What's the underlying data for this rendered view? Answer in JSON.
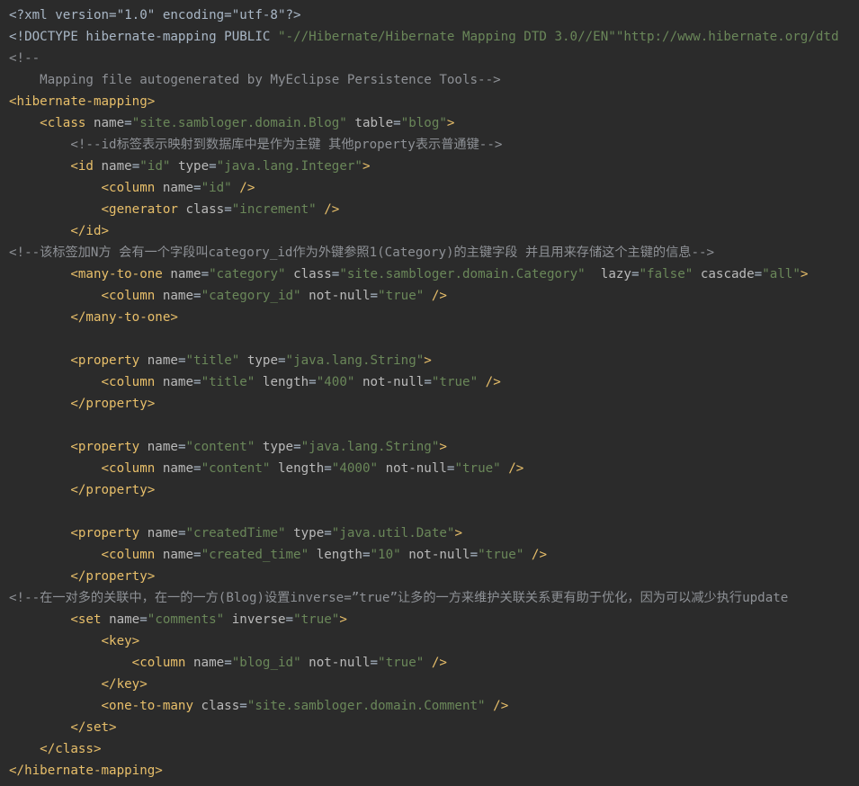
{
  "editor": {
    "language": "xml",
    "colors": {
      "background": "#2b2b2b",
      "text": "#a9b7c6",
      "tag": "#e8bf6a",
      "attribute_name": "#bababa",
      "attribute_value": "#6a8759",
      "comment": "#8e9196"
    },
    "lines": [
      {
        "indent": "",
        "tokens": [
          {
            "t": "pi",
            "v": "<?xml version=\"1.0\" encoding=\"utf-8\"?>"
          }
        ]
      },
      {
        "indent": "",
        "tokens": [
          {
            "t": "pun",
            "v": "<!DOCTYPE hibernate-mapping PUBLIC "
          },
          {
            "t": "atv",
            "v": "\"-//Hibernate/Hibernate Mapping DTD 3.0//EN\""
          },
          {
            "t": "atv",
            "v": "\"http://www.hibernate.org/dtd"
          }
        ]
      },
      {
        "indent": "",
        "tokens": [
          {
            "t": "cmt",
            "v": "<!--"
          }
        ]
      },
      {
        "indent": "    ",
        "tokens": [
          {
            "t": "cmt",
            "v": "Mapping file autogenerated by MyEclipse Persistence Tools-->"
          }
        ]
      },
      {
        "indent": "",
        "tokens": [
          {
            "t": "tag",
            "v": "<hibernate-mapping"
          },
          {
            "t": "tag",
            "v": ">"
          }
        ]
      },
      {
        "indent": "    ",
        "tokens": [
          {
            "t": "tag",
            "v": "<class "
          },
          {
            "t": "atn",
            "v": "name"
          },
          {
            "t": "pun",
            "v": "="
          },
          {
            "t": "atv",
            "v": "\"site.sambloger.domain.Blog\""
          },
          {
            "t": "pun",
            "v": " "
          },
          {
            "t": "atn",
            "v": "table"
          },
          {
            "t": "pun",
            "v": "="
          },
          {
            "t": "atv",
            "v": "\"blog\""
          },
          {
            "t": "tag",
            "v": ">"
          }
        ]
      },
      {
        "indent": "        ",
        "tokens": [
          {
            "t": "cmt",
            "v": "<!--id标签表示映射到数据库中是作为主键 其他property表示普通键-->"
          }
        ]
      },
      {
        "indent": "        ",
        "tokens": [
          {
            "t": "tag",
            "v": "<id "
          },
          {
            "t": "atn",
            "v": "name"
          },
          {
            "t": "pun",
            "v": "="
          },
          {
            "t": "atv",
            "v": "\"id\""
          },
          {
            "t": "pun",
            "v": " "
          },
          {
            "t": "atn",
            "v": "type"
          },
          {
            "t": "pun",
            "v": "="
          },
          {
            "t": "atv",
            "v": "\"java.lang.Integer\""
          },
          {
            "t": "tag",
            "v": ">"
          }
        ]
      },
      {
        "indent": "            ",
        "tokens": [
          {
            "t": "tag",
            "v": "<column "
          },
          {
            "t": "atn",
            "v": "name"
          },
          {
            "t": "pun",
            "v": "="
          },
          {
            "t": "atv",
            "v": "\"id\""
          },
          {
            "t": "pun",
            "v": " "
          },
          {
            "t": "tag",
            "v": "/>"
          }
        ]
      },
      {
        "indent": "            ",
        "tokens": [
          {
            "t": "tag",
            "v": "<generator "
          },
          {
            "t": "atn",
            "v": "class"
          },
          {
            "t": "pun",
            "v": "="
          },
          {
            "t": "atv",
            "v": "\"increment\""
          },
          {
            "t": "pun",
            "v": " "
          },
          {
            "t": "tag",
            "v": "/>"
          }
        ]
      },
      {
        "indent": "        ",
        "tokens": [
          {
            "t": "tag",
            "v": "</id>"
          }
        ]
      },
      {
        "indent": "",
        "tokens": [
          {
            "t": "cmt",
            "v": "<!--该标签加N方 会有一个字段叫category_id作为外键参照1(Category)的主键字段 并且用来存储这个主键的信息-->"
          }
        ]
      },
      {
        "indent": "        ",
        "tokens": [
          {
            "t": "tag",
            "v": "<many-to-one "
          },
          {
            "t": "atn",
            "v": "name"
          },
          {
            "t": "pun",
            "v": "="
          },
          {
            "t": "atv",
            "v": "\"category\""
          },
          {
            "t": "pun",
            "v": " "
          },
          {
            "t": "atn",
            "v": "class"
          },
          {
            "t": "pun",
            "v": "="
          },
          {
            "t": "atv",
            "v": "\"site.sambloger.domain.Category\""
          },
          {
            "t": "pun",
            "v": "  "
          },
          {
            "t": "atn",
            "v": "lazy"
          },
          {
            "t": "pun",
            "v": "="
          },
          {
            "t": "atv",
            "v": "\"false\""
          },
          {
            "t": "pun",
            "v": " "
          },
          {
            "t": "atn",
            "v": "cascade"
          },
          {
            "t": "pun",
            "v": "="
          },
          {
            "t": "atv",
            "v": "\"all\""
          },
          {
            "t": "tag",
            "v": ">"
          }
        ]
      },
      {
        "indent": "            ",
        "tokens": [
          {
            "t": "tag",
            "v": "<column "
          },
          {
            "t": "atn",
            "v": "name"
          },
          {
            "t": "pun",
            "v": "="
          },
          {
            "t": "atv",
            "v": "\"category_id\""
          },
          {
            "t": "pun",
            "v": " "
          },
          {
            "t": "atn",
            "v": "not-null"
          },
          {
            "t": "pun",
            "v": "="
          },
          {
            "t": "atv",
            "v": "\"true\""
          },
          {
            "t": "pun",
            "v": " "
          },
          {
            "t": "tag",
            "v": "/>"
          }
        ]
      },
      {
        "indent": "        ",
        "tokens": [
          {
            "t": "tag",
            "v": "</many-to-one>"
          }
        ]
      },
      {
        "indent": "",
        "tokens": []
      },
      {
        "indent": "        ",
        "tokens": [
          {
            "t": "tag",
            "v": "<property "
          },
          {
            "t": "atn",
            "v": "name"
          },
          {
            "t": "pun",
            "v": "="
          },
          {
            "t": "atv",
            "v": "\"title\""
          },
          {
            "t": "pun",
            "v": " "
          },
          {
            "t": "atn",
            "v": "type"
          },
          {
            "t": "pun",
            "v": "="
          },
          {
            "t": "atv",
            "v": "\"java.lang.String\""
          },
          {
            "t": "tag",
            "v": ">"
          }
        ]
      },
      {
        "indent": "            ",
        "tokens": [
          {
            "t": "tag",
            "v": "<column "
          },
          {
            "t": "atn",
            "v": "name"
          },
          {
            "t": "pun",
            "v": "="
          },
          {
            "t": "atv",
            "v": "\"title\""
          },
          {
            "t": "pun",
            "v": " "
          },
          {
            "t": "atn",
            "v": "length"
          },
          {
            "t": "pun",
            "v": "="
          },
          {
            "t": "atv",
            "v": "\"400\""
          },
          {
            "t": "pun",
            "v": " "
          },
          {
            "t": "atn",
            "v": "not-null"
          },
          {
            "t": "pun",
            "v": "="
          },
          {
            "t": "atv",
            "v": "\"true\""
          },
          {
            "t": "pun",
            "v": " "
          },
          {
            "t": "tag",
            "v": "/>"
          }
        ]
      },
      {
        "indent": "        ",
        "tokens": [
          {
            "t": "tag",
            "v": "</property>"
          }
        ]
      },
      {
        "indent": "",
        "tokens": []
      },
      {
        "indent": "        ",
        "tokens": [
          {
            "t": "tag",
            "v": "<property "
          },
          {
            "t": "atn",
            "v": "name"
          },
          {
            "t": "pun",
            "v": "="
          },
          {
            "t": "atv",
            "v": "\"content\""
          },
          {
            "t": "pun",
            "v": " "
          },
          {
            "t": "atn",
            "v": "type"
          },
          {
            "t": "pun",
            "v": "="
          },
          {
            "t": "atv",
            "v": "\"java.lang.String\""
          },
          {
            "t": "tag",
            "v": ">"
          }
        ]
      },
      {
        "indent": "            ",
        "tokens": [
          {
            "t": "tag",
            "v": "<column "
          },
          {
            "t": "atn",
            "v": "name"
          },
          {
            "t": "pun",
            "v": "="
          },
          {
            "t": "atv",
            "v": "\"content\""
          },
          {
            "t": "pun",
            "v": " "
          },
          {
            "t": "atn",
            "v": "length"
          },
          {
            "t": "pun",
            "v": "="
          },
          {
            "t": "atv",
            "v": "\"4000\""
          },
          {
            "t": "pun",
            "v": " "
          },
          {
            "t": "atn",
            "v": "not-null"
          },
          {
            "t": "pun",
            "v": "="
          },
          {
            "t": "atv",
            "v": "\"true\""
          },
          {
            "t": "pun",
            "v": " "
          },
          {
            "t": "tag",
            "v": "/>"
          }
        ]
      },
      {
        "indent": "        ",
        "tokens": [
          {
            "t": "tag",
            "v": "</property>"
          }
        ]
      },
      {
        "indent": "",
        "tokens": []
      },
      {
        "indent": "        ",
        "tokens": [
          {
            "t": "tag",
            "v": "<property "
          },
          {
            "t": "atn",
            "v": "name"
          },
          {
            "t": "pun",
            "v": "="
          },
          {
            "t": "atv",
            "v": "\"createdTime\""
          },
          {
            "t": "pun",
            "v": " "
          },
          {
            "t": "atn",
            "v": "type"
          },
          {
            "t": "pun",
            "v": "="
          },
          {
            "t": "atv",
            "v": "\"java.util.Date\""
          },
          {
            "t": "tag",
            "v": ">"
          }
        ]
      },
      {
        "indent": "            ",
        "tokens": [
          {
            "t": "tag",
            "v": "<column "
          },
          {
            "t": "atn",
            "v": "name"
          },
          {
            "t": "pun",
            "v": "="
          },
          {
            "t": "atv",
            "v": "\"created_time\""
          },
          {
            "t": "pun",
            "v": " "
          },
          {
            "t": "atn",
            "v": "length"
          },
          {
            "t": "pun",
            "v": "="
          },
          {
            "t": "atv",
            "v": "\"10\""
          },
          {
            "t": "pun",
            "v": " "
          },
          {
            "t": "atn",
            "v": "not-null"
          },
          {
            "t": "pun",
            "v": "="
          },
          {
            "t": "atv",
            "v": "\"true\""
          },
          {
            "t": "pun",
            "v": " "
          },
          {
            "t": "tag",
            "v": "/>"
          }
        ]
      },
      {
        "indent": "        ",
        "tokens": [
          {
            "t": "tag",
            "v": "</property>"
          }
        ]
      },
      {
        "indent": "",
        "tokens": [
          {
            "t": "cmt",
            "v": "<!--在一对多的关联中，在一的一方(Blog)设置inverse=”true”让多的一方来维护关联关系更有助于优化，因为可以减少执行update"
          }
        ]
      },
      {
        "indent": "        ",
        "tokens": [
          {
            "t": "tag",
            "v": "<set "
          },
          {
            "t": "atn",
            "v": "name"
          },
          {
            "t": "pun",
            "v": "="
          },
          {
            "t": "atv",
            "v": "\"comments\""
          },
          {
            "t": "pun",
            "v": " "
          },
          {
            "t": "atn",
            "v": "inverse"
          },
          {
            "t": "pun",
            "v": "="
          },
          {
            "t": "atv",
            "v": "\"true\""
          },
          {
            "t": "tag",
            "v": ">"
          }
        ]
      },
      {
        "indent": "            ",
        "tokens": [
          {
            "t": "tag",
            "v": "<key>"
          }
        ]
      },
      {
        "indent": "                ",
        "tokens": [
          {
            "t": "tag",
            "v": "<column "
          },
          {
            "t": "atn",
            "v": "name"
          },
          {
            "t": "pun",
            "v": "="
          },
          {
            "t": "atv",
            "v": "\"blog_id\""
          },
          {
            "t": "pun",
            "v": " "
          },
          {
            "t": "atn",
            "v": "not-null"
          },
          {
            "t": "pun",
            "v": "="
          },
          {
            "t": "atv",
            "v": "\"true\""
          },
          {
            "t": "pun",
            "v": " "
          },
          {
            "t": "tag",
            "v": "/>"
          }
        ]
      },
      {
        "indent": "            ",
        "tokens": [
          {
            "t": "tag",
            "v": "</key>"
          }
        ]
      },
      {
        "indent": "            ",
        "tokens": [
          {
            "t": "tag",
            "v": "<one-to-many "
          },
          {
            "t": "atn",
            "v": "class"
          },
          {
            "t": "pun",
            "v": "="
          },
          {
            "t": "atv",
            "v": "\"site.sambloger.domain.Comment\""
          },
          {
            "t": "pun",
            "v": " "
          },
          {
            "t": "tag",
            "v": "/>"
          }
        ]
      },
      {
        "indent": "        ",
        "tokens": [
          {
            "t": "tag",
            "v": "</set>"
          }
        ]
      },
      {
        "indent": "    ",
        "tokens": [
          {
            "t": "tag",
            "v": "</class>"
          }
        ]
      },
      {
        "indent": "",
        "tokens": [
          {
            "t": "tag",
            "v": "</hibernate-mapping>"
          }
        ]
      }
    ]
  }
}
